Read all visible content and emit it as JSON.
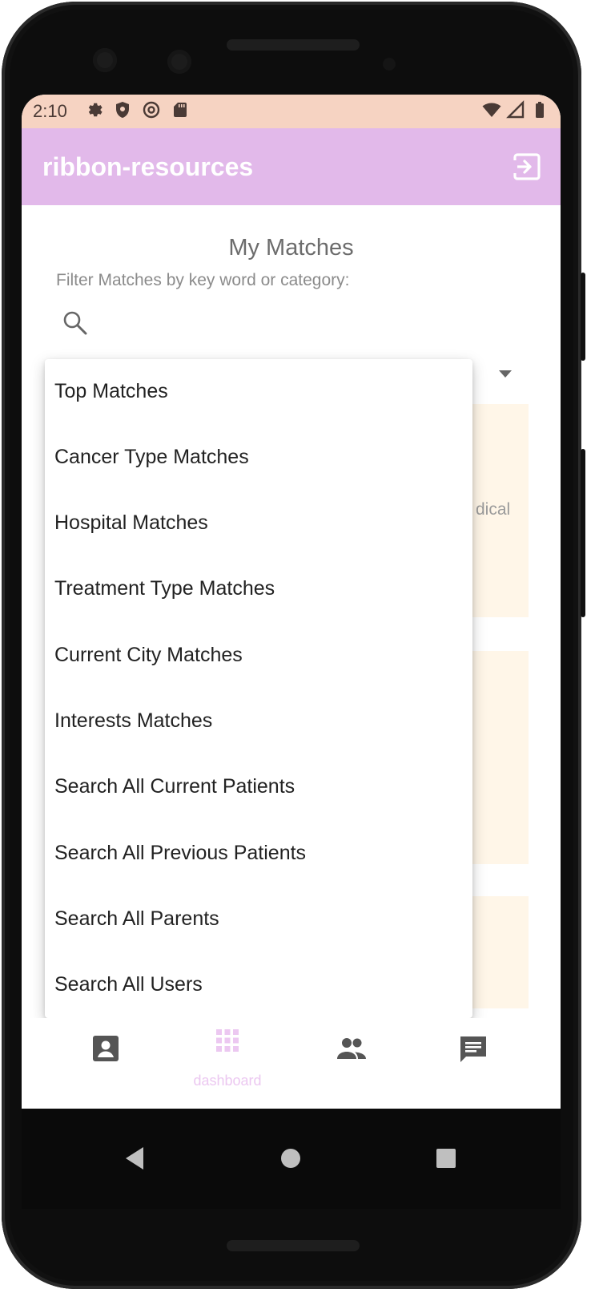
{
  "status_bar": {
    "time": "2:10",
    "left_icons": [
      "gear-icon",
      "shield-icon",
      "at-sign-icon",
      "sd-card-icon"
    ],
    "right_icons": [
      "wifi-icon",
      "signal-icon",
      "battery-icon"
    ]
  },
  "app_bar": {
    "title": "ribbon-resources",
    "action_icon": "logout-icon"
  },
  "page": {
    "title": "My Matches",
    "filter_label": "Filter Matches by key word or category:",
    "search": {
      "value": "",
      "placeholder": ""
    }
  },
  "background_fragments": {
    "card1_text": "dical"
  },
  "dropdown": {
    "options": [
      "Top Matches",
      "Cancer Type Matches",
      "Hospital Matches",
      "Treatment Type Matches",
      "Current City Matches",
      "Interests Matches",
      "Search All Current Patients",
      "Search All Previous Patients",
      "Search All Parents",
      "Search All Users"
    ]
  },
  "bottom_nav": {
    "items": [
      {
        "icon": "contact-card-icon",
        "label": ""
      },
      {
        "icon": "grid-dashboard-icon",
        "label": "dashboard"
      },
      {
        "icon": "people-icon",
        "label": ""
      },
      {
        "icon": "chat-icon",
        "label": ""
      }
    ],
    "active_color": "#ecc8f1"
  },
  "colors": {
    "status_bar": "#f6d3c2",
    "app_bar": "#e2b9ea",
    "card": "#fff6e8"
  }
}
